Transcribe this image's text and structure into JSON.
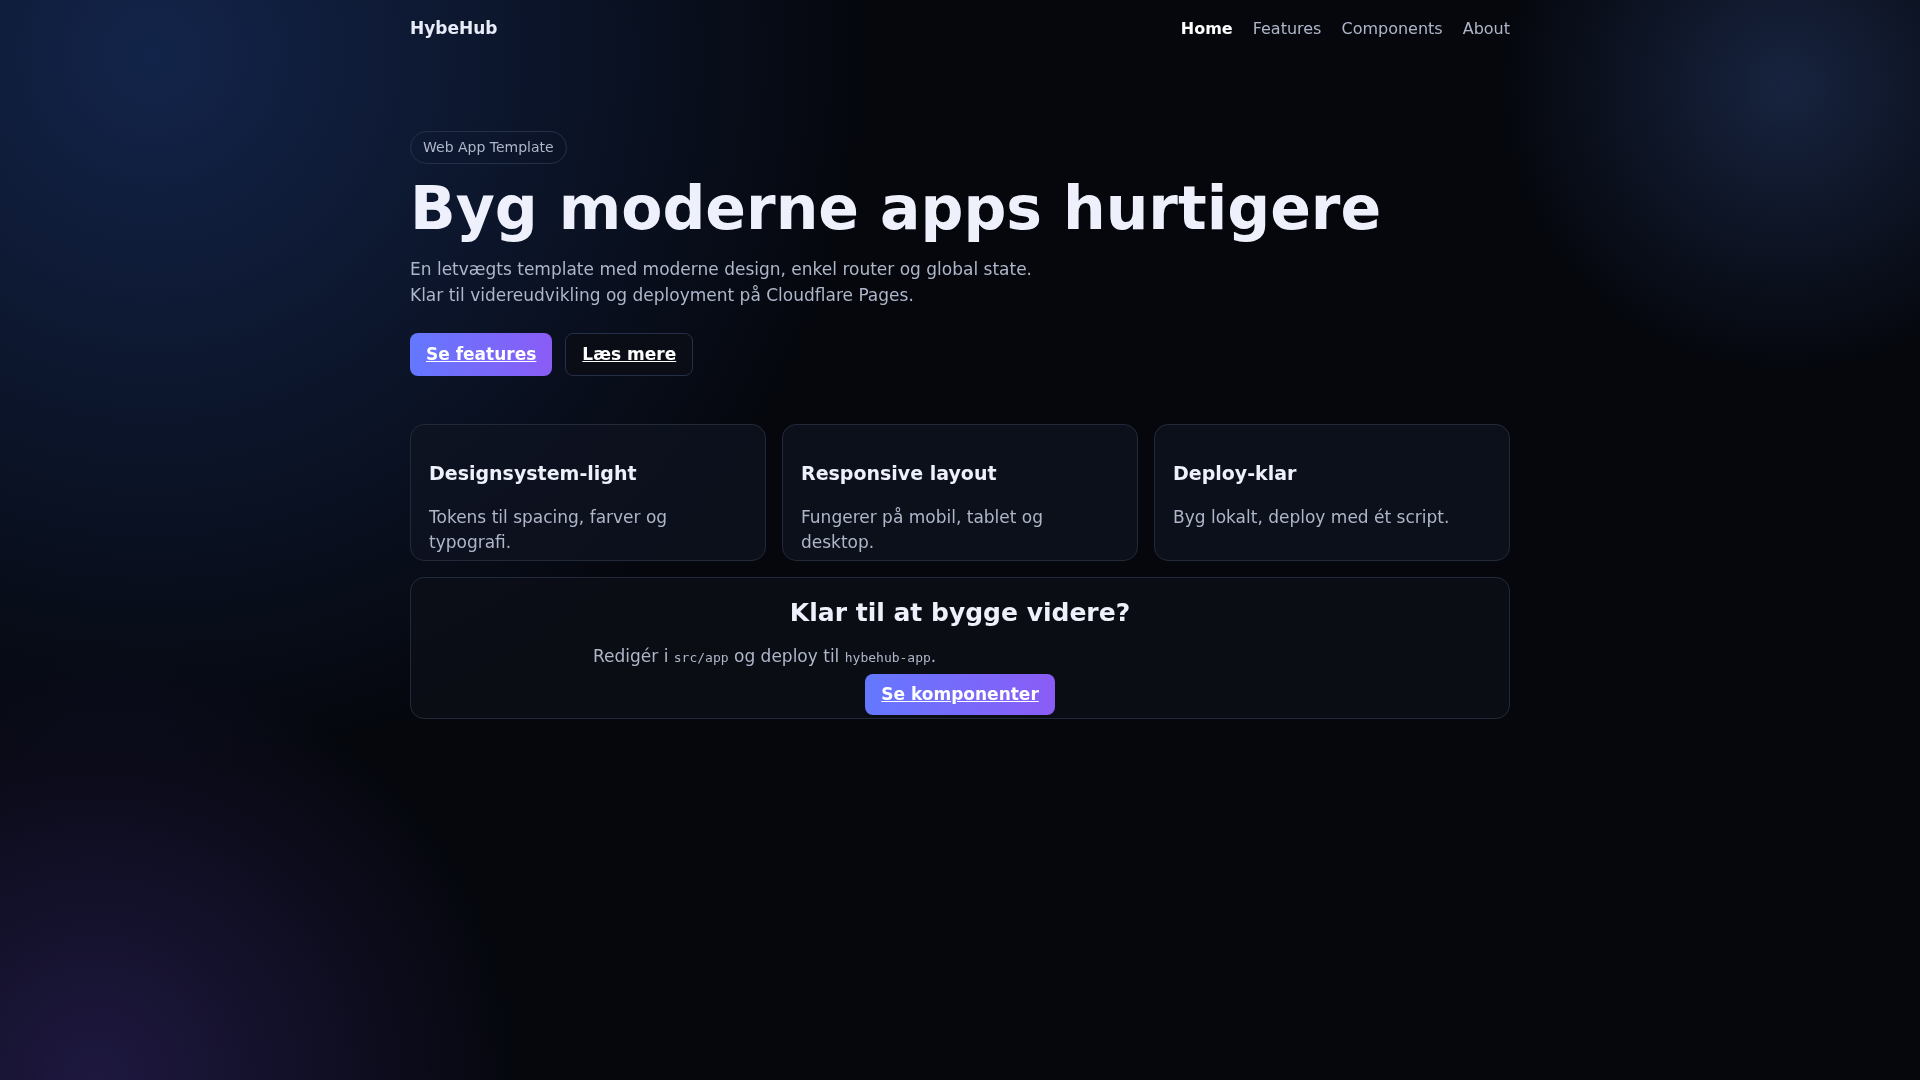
{
  "brand": "HybeHub",
  "nav": [
    {
      "label": "Home",
      "selected": true
    },
    {
      "label": "Features",
      "selected": false
    },
    {
      "label": "Components",
      "selected": false
    },
    {
      "label": "About",
      "selected": false
    }
  ],
  "hero": {
    "badge": "Web App Template",
    "title": "Byg moderne apps hurtigere",
    "lead": "En letvægts template med moderne design, enkel router og global state. Klar til videreudvikling og deployment på Cloudflare Pages.",
    "buttons": [
      {
        "label": "Se features",
        "kind": "primary"
      },
      {
        "label": "Læs mere",
        "kind": "secondary"
      }
    ]
  },
  "cards": [
    {
      "title": "Designsystem-light",
      "text": "Tokens til spacing, farver og typografi."
    },
    {
      "title": "Responsive layout",
      "text": "Fungerer på mobil, tablet og desktop."
    },
    {
      "title": "Deploy-klar",
      "text": "Byg lokalt, deploy med ét script."
    }
  ],
  "cta": {
    "title": "Klar til at bygge videre?",
    "text": [
      {
        "kind": "plain",
        "text": "Redigér i "
      },
      {
        "kind": "code",
        "text": "src/app"
      },
      {
        "kind": "plain",
        "text": " og deploy til "
      },
      {
        "kind": "code",
        "text": "hybehub-app"
      },
      {
        "kind": "plain",
        "text": "."
      }
    ],
    "button": {
      "label": "Se komponenter",
      "kind": "primary"
    }
  }
}
